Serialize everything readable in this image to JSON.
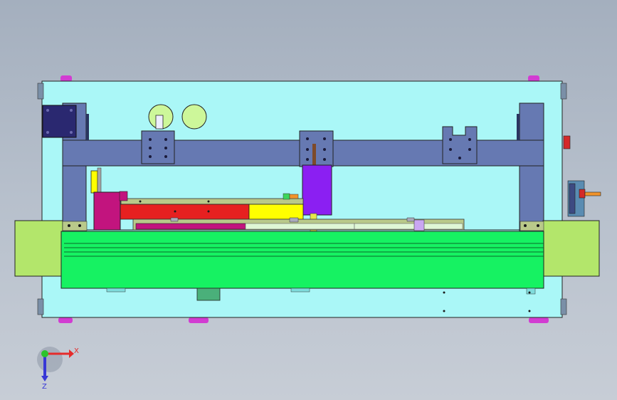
{
  "viewport": {
    "background_top": "#a4afbe",
    "background_bottom": "#c7cdd6"
  },
  "colors": {
    "base_plate": "#aaf7f7",
    "frame": "#6679b2",
    "dark_frame": "#3d4b82",
    "motor_block": "#2a2870",
    "green_rail": "#16f262",
    "side_block": "#b3e66b",
    "cylinder_purple": "#8b1ff2",
    "red_bar": "#e62020",
    "yellow_bar": "#ffff00",
    "magenta_block": "#c2147e",
    "olive_rail": "#b9c98a",
    "fitting_red": "#d42a2a",
    "fitting_orange": "#f0932b",
    "foot_magenta": "#d23cd2",
    "gauge_fill": "#cdf79a"
  },
  "triad": {
    "x_label": "X",
    "z_label": "Z",
    "x_color": "#e52b2b",
    "y_color": "#2bc42b",
    "z_color": "#3838d6"
  }
}
